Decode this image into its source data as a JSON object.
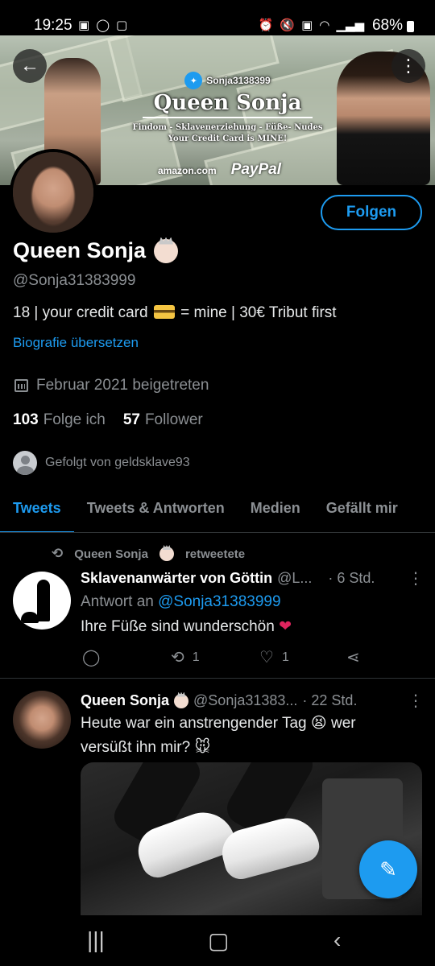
{
  "status_bar": {
    "time": "19:25",
    "left_icons": [
      "image-icon",
      "whatsapp-icon",
      "app-icon"
    ],
    "right_icons": [
      "alarm-icon",
      "mute-icon",
      "lock-icon",
      "wifi-icon",
      "signal-icon"
    ],
    "battery": "68%"
  },
  "banner": {
    "handle": "Sonja3138399",
    "title": "Queen Sonja",
    "line1": "Findom - Sklavenerziehung - Füße- Nudes",
    "line2": "Your Credit Card is MINE!",
    "brand1": "amazon.com",
    "brand2": "PayPal"
  },
  "header": {
    "back_label": "←",
    "more_label": "⋮",
    "follow_label": "Folgen"
  },
  "profile": {
    "name": "Queen Sonja",
    "handle": "@Sonja31383999",
    "bio_part1": "18 | your credit card",
    "bio_part2": "= mine | 30€ Tribut first",
    "translate": "Biografie übersetzen",
    "joined": "Februar 2021 beigetreten",
    "following_count": "103",
    "following_label": "Folge ich",
    "followers_count": "57",
    "followers_label": "Follower",
    "followed_by": "Gefolgt von geldsklave93"
  },
  "tabs": [
    "Tweets",
    "Tweets & Antworten",
    "Medien",
    "Gefällt mir"
  ],
  "tweets": [
    {
      "retweet_label": "Queen Sonja",
      "retweet_suffix": "retweetete",
      "author": "Sklavenanwärter von Göttin",
      "handle": "@L...",
      "time": "· 6 Std.",
      "reply_prefix": "Antwort an",
      "reply_handle": "@Sonja31383999",
      "text": "Ihre Füße sind wunderschön",
      "retweets": "1",
      "likes": "1"
    },
    {
      "author": "Queen Sonja",
      "handle": "@Sonja31383...",
      "time": "· 22 Std.",
      "text_line1": "Heute war ein anstrengender Tag",
      "text_line1_end": "wer",
      "text_line2": "versüßt ihn mir?"
    }
  ],
  "colors": {
    "accent": "#1d9bf0",
    "background": "#000000",
    "secondary_text": "#8b8f93"
  }
}
